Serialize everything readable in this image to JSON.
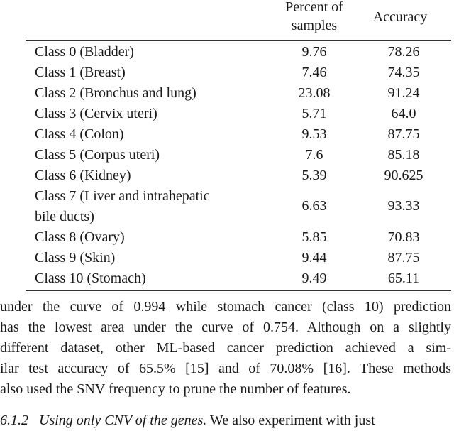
{
  "table": {
    "columns": [
      "",
      "Percent of samples",
      "Accuracy"
    ],
    "header": {
      "percent_line1": "Percent of",
      "percent_line2": "samples",
      "accuracy": "Accuracy"
    },
    "rows": [
      {
        "class": "Class 0 (Bladder)",
        "percent": "9.76",
        "accuracy": "78.26"
      },
      {
        "class": "Class 1 (Breast)",
        "percent": "7.46",
        "accuracy": "74.35"
      },
      {
        "class": "Class 2 (Bronchus and lung)",
        "percent": "23.08",
        "accuracy": "91.24"
      },
      {
        "class": "Class 3 (Cervix uteri)",
        "percent": "5.71",
        "accuracy": "64.0"
      },
      {
        "class": "Class 4 (Colon)",
        "percent": "9.53",
        "accuracy": "87.75"
      },
      {
        "class": "Class 5 (Corpus uteri)",
        "percent": "7.6",
        "accuracy": "85.18"
      },
      {
        "class": "Class 6 (Kidney)",
        "percent": "5.39",
        "accuracy": "90.625"
      },
      {
        "class_line1": "Class 7 (Liver and intrahepatic",
        "class_line2": "bile ducts)",
        "percent": "6.63",
        "accuracy": "93.33"
      },
      {
        "class": "Class 8 (Ovary)",
        "percent": "5.85",
        "accuracy": "70.83"
      },
      {
        "class": "Class 9 (Skin)",
        "percent": "9.44",
        "accuracy": "87.75"
      },
      {
        "class": "Class 10 (Stomach)",
        "percent": "9.49",
        "accuracy": "65.11"
      }
    ]
  },
  "paragraph": {
    "lines": [
      "under the curve of 0.994 while stomach cancer (class 10) prediction",
      "has the lowest area under the curve of 0.754. Although on a slightly",
      "different dataset, other ML-based cancer prediction achieved a sim-",
      "ilar test accuracy of 65.5% [15] and of 70.08% [16]. These methods",
      "also used the SNV frequency to prune the number of features."
    ]
  },
  "subsection": {
    "number": "6.1.2",
    "title": "Using only CNV of the genes.",
    "text": "We also experiment with just"
  }
}
